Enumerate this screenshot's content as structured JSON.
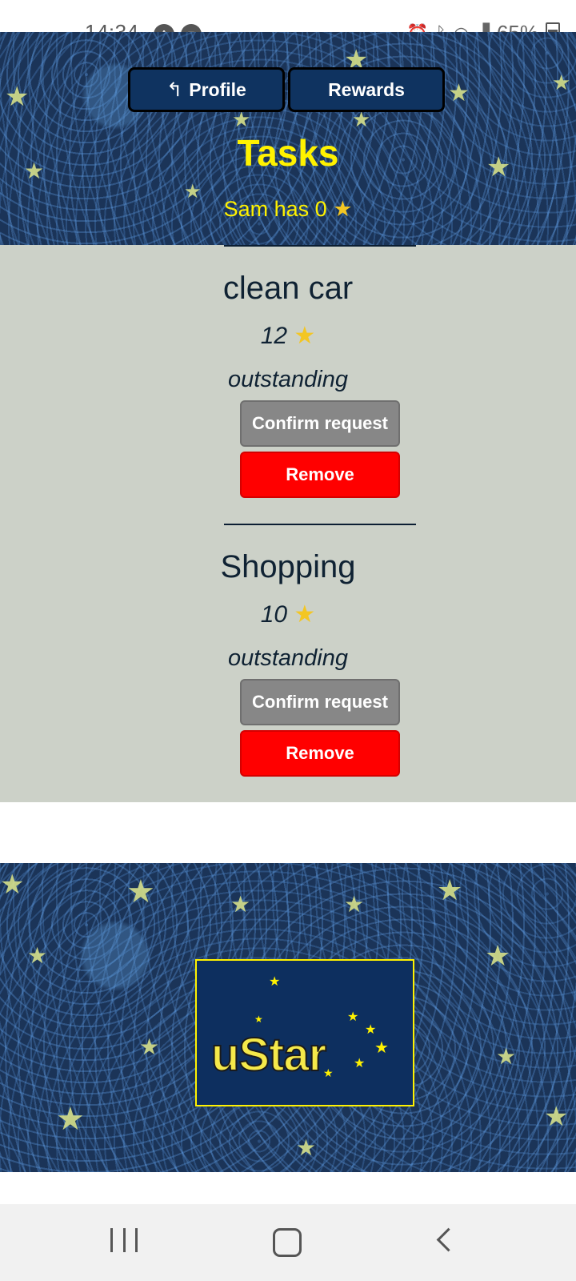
{
  "status_bar": {
    "time": "14:34",
    "battery_percent": "65%",
    "icons": [
      "notification-icon",
      "cast-icon",
      "alarm-icon",
      "bluetooth-icon",
      "wifi-icon",
      "signal-icon",
      "battery-icon"
    ]
  },
  "header": {
    "nav": {
      "profile_arrow": "↰",
      "profile_label": "Profile",
      "rewards_label": "Rewards"
    },
    "title": "Tasks",
    "stars_text": "Sam has 0",
    "stars_icon": "★"
  },
  "tasks": [
    {
      "name": "clean car",
      "points": "12",
      "points_icon": "★",
      "status": "outstanding",
      "confirm_label": "Confirm request",
      "remove_label": "Remove"
    },
    {
      "name": "Shopping",
      "points": "10",
      "points_icon": "★",
      "status": "outstanding",
      "confirm_label": "Confirm request",
      "remove_label": "Remove"
    }
  ],
  "footer": {
    "logo_text": "uStar"
  },
  "colors": {
    "accent_yellow": "#fff200",
    "button_navy": "#0f3360",
    "confirm_gray": "#878787",
    "remove_red": "#ff0000",
    "list_background": "#ccd1c8"
  }
}
